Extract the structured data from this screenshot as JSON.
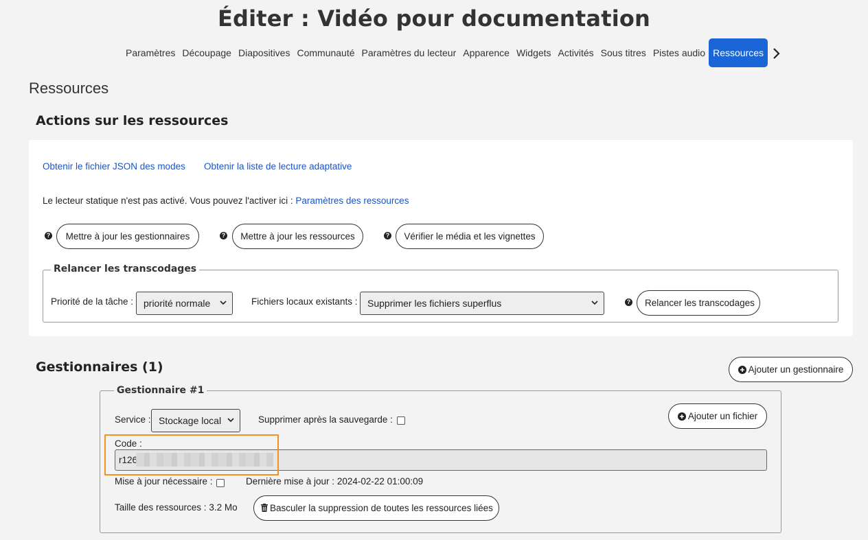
{
  "page": {
    "title": "Éditer : Vidéo pour documentation"
  },
  "tabs": [
    "Paramètres",
    "Découpage",
    "Diapositives",
    "Communauté",
    "Paramètres du lecteur",
    "Apparence",
    "Widgets",
    "Activités",
    "Sous titres",
    "Pistes audio",
    "Ressources"
  ],
  "active_tab": "Ressources",
  "section": {
    "title": "Ressources",
    "actions_title": "Actions sur les ressources",
    "links": {
      "json_modes": "Obtenir le fichier JSON des modes",
      "adaptive_playlist": "Obtenir la liste de lecture adaptative"
    },
    "static_player_text": "Le lecteur statique n'est pas activé. Vous pouvez l'activer ici :",
    "static_player_link": "Paramètres des ressources",
    "buttons": {
      "update_managers": "Mettre à jour les gestionnaires",
      "update_resources": "Mettre à jour les ressources",
      "check_media": "Vérifier le média et les vignettes"
    }
  },
  "transcode": {
    "legend": "Relancer les transcodages",
    "priority_label": "Priorité de la tâche :",
    "priority_value": "priorité normale",
    "local_files_label": "Fichiers locaux existants :",
    "local_files_value": "Supprimer les fichiers superflus",
    "relaunch_button": "Relancer les transcodages"
  },
  "managers": {
    "title": "Gestionnaires (1)",
    "add_manager_button": "Ajouter un gestionnaire",
    "manager": {
      "legend": "Gestionnaire #1",
      "service_label": "Service :",
      "service_value": "Stockage local",
      "delete_after_backup_label": "Supprimer après la sauvegarde :",
      "add_file_button": "Ajouter un fichier",
      "code_label": "Code :",
      "code_value": "r126",
      "update_needed_label": "Mise à jour nécessaire :",
      "last_update_label": "Dernière mise à jour :",
      "last_update_value": "2024-02-22 01:00:09",
      "resource_size_label": "Taille des ressources :",
      "resource_size_value": "3.2 Mo",
      "toggle_delete_button": "Basculer la suppression de toutes les ressources liées"
    }
  },
  "colors": {
    "accent": "#1a66d6",
    "link": "#1b55c5",
    "highlight": "#f0941d"
  }
}
